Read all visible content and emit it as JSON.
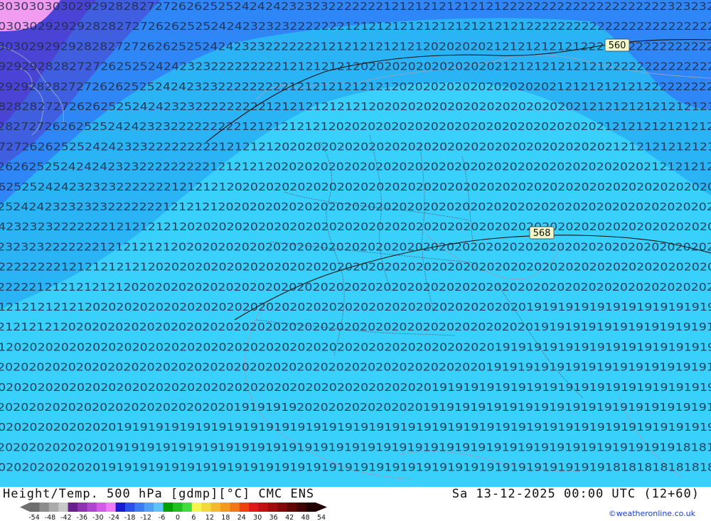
{
  "title": "Height/Temp. 500 hPa [gdmp][°C] CMC ENS",
  "datetime": "Sa 13-12-2025 00:00 UTC (12+60)",
  "credit": "©weatheronline.co.uk",
  "contour_labels": [
    {
      "text": "560"
    },
    {
      "text": "568"
    }
  ],
  "field_row_values": [
    "30303030302929282827272626252524242423232322222221212121212121212222222222222222222223232323",
    "30303029292928282727262625252424232323222222212121212121212121212121222222222222222222222222",
    "30302929292828272726262525242423232222222121212121212120202020212121212121222222222222222222",
    "29292928282727262525242423232222222221212121212020202020202020202121212121212122222222222222",
    "29292828272726262525242423232222222221212121212121202020202020202020202121212121212222222222",
    "28282827272626252524242323222222222121212121212120202020202020202020202020212121212121212121",
    "28272726262525242423232222222221212121212120202020202020202020202020202020202121212121212121",
    "27272626252524242323222222222121212120202020202020202020202020202020202020202021212121212121",
    "26262525242424232322222222212121212020202020202020202020202020202020202020202020202121212121",
    "26252524242323232222222121212120202020202020202020202020202020202020202020202020202020202020",
    "25242423232323222222212121212020202020202020202020202020202020202020202020202020202020202020",
    "24232323222222212121212120202020202020202020202020202020202020202020202020202020202020202020",
    "23232322222221212121212020202020202020202020202020202020202020202020202020202020202020202020",
    "22222222212121212121202020202020202020202020202020202020202020202020202020202020202020202020",
    "22222121212121212020202020202020202020202020202020202020202020202020202020202020202020202020",
    "21212121212120202020202020202020202020202020202020202020202020202020191919191919191919191919",
    "21212121202020202020202020202020202020202020202020202020202020202020191919191919191919191919",
    "21202020202020202020202020202020202020202020202020202020202020201919191919191919191919191919",
    "20202020202020202020202020202020202020202020202020202020202020191919191919191919191919191919",
    "20202020202020202020202020202020202020202020202020202020191919191919191919191919191919191919",
    "20202020202020202020202020202019191919202020202020202019191919191919191919191919191919191919",
    "20202020202020201919191919191919191919191919191919191919191919191919191919191919191919191919",
    "20202020202020191919191919191919191919191919191919191919191919191919191919191919191919181818",
    "20202020202020191919191919191919191919191919191919191919191919191919191919191918181818181818"
  ],
  "legend": {
    "values": [
      "-54",
      "-48",
      "-42",
      "-36",
      "-30",
      "-24",
      "-18",
      "-12",
      "-6",
      "0",
      "6",
      "12",
      "18",
      "24",
      "30",
      "36",
      "42",
      "48",
      "54"
    ],
    "colors": [
      "#6e6e6e",
      "#8c8c8c",
      "#aaaaaa",
      "#c8c8c8",
      "#6a1f8e",
      "#8d32b0",
      "#b045d0",
      "#d45ae8",
      "#f07cf5",
      "#1a1ad0",
      "#2a52e6",
      "#3c7af0",
      "#4fa0f5",
      "#5fc2fb",
      "#00a000",
      "#20c020",
      "#40dc40",
      "#f5f550",
      "#f5d840",
      "#f5b830",
      "#f59a20",
      "#f07818",
      "#f04010",
      "#e01818",
      "#c01010",
      "#a00c0c",
      "#800808",
      "#600404",
      "#400202",
      "#200000"
    ]
  },
  "colors": {
    "zone_blue": "#2f86f6",
    "zone_lightblue": "#2ab3f5",
    "zone_cyan": "#39d0fb",
    "zone_purple": "#3f5fe0",
    "zone_violet": "#4a43d6",
    "zone_pink": "#f19cf0",
    "field_text": "#202a44",
    "coast": "#8aa6c6",
    "border": "#50607a",
    "isohypse": "#111111",
    "label_box": "#f2f7c8"
  }
}
